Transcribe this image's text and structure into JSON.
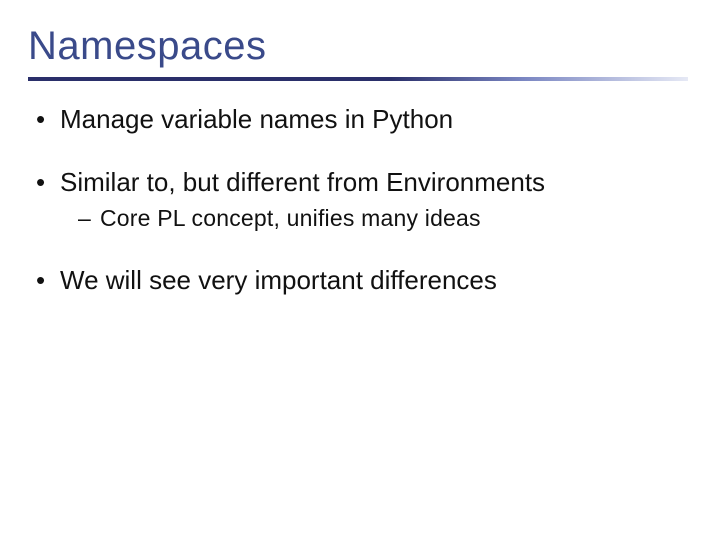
{
  "title": "Namespaces",
  "bullets": [
    {
      "text": "Manage variable names in Python",
      "sub": []
    },
    {
      "text": "Similar to, but different from Environments",
      "sub": [
        "Core PL concept, unifies many ideas"
      ]
    },
    {
      "text": "We will see very important differences",
      "sub": []
    }
  ]
}
